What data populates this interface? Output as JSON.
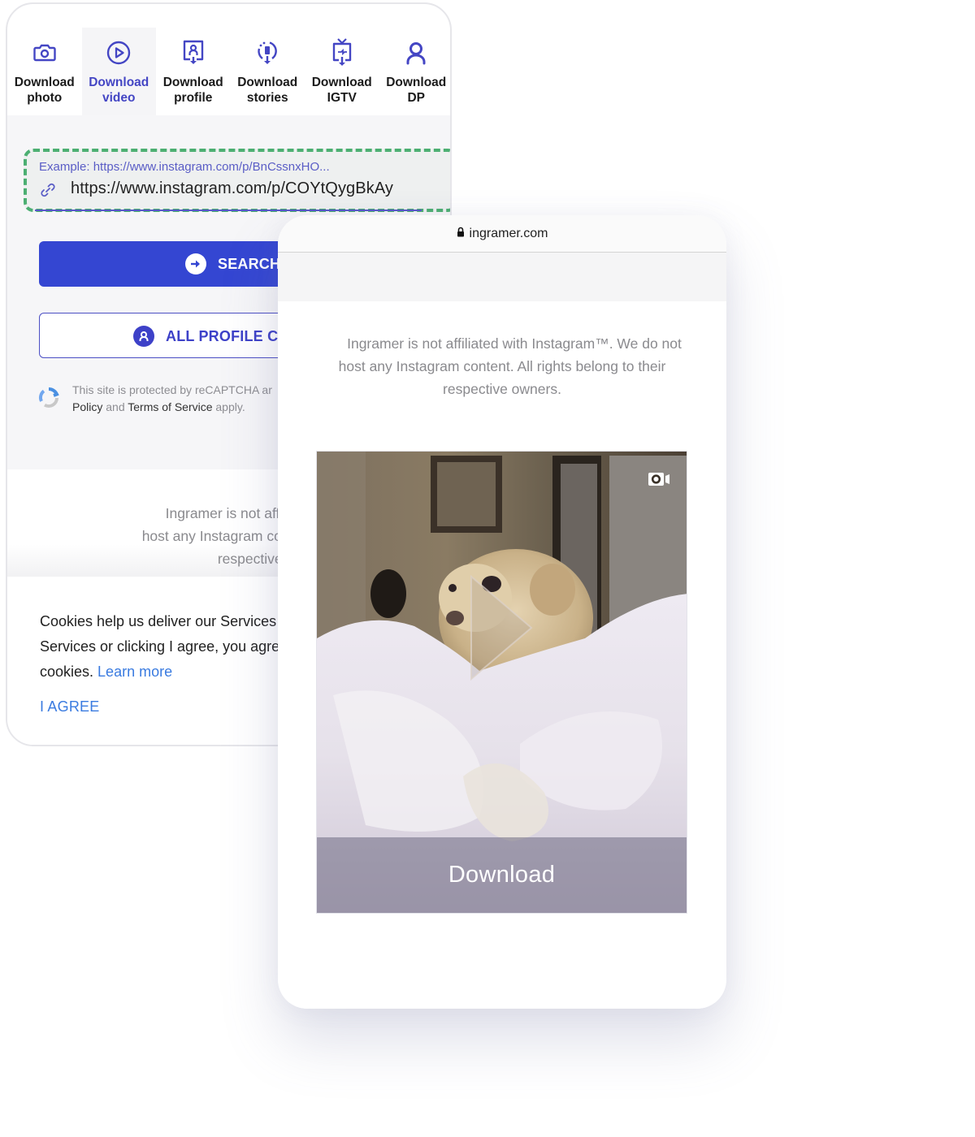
{
  "left_panel": {
    "tabs": [
      {
        "label_line1": "Download",
        "label_line2": "photo",
        "icon": "camera-icon",
        "active": false
      },
      {
        "label_line1": "Download",
        "label_line2": "video",
        "icon": "play-circle-icon",
        "active": true
      },
      {
        "label_line1": "Download",
        "label_line2": "profile",
        "icon": "profile-download-icon",
        "active": false
      },
      {
        "label_line1": "Download",
        "label_line2": "stories",
        "icon": "stories-download-icon",
        "active": false
      },
      {
        "label_line1": "Download",
        "label_line2": "IGTV",
        "icon": "igtv-download-icon",
        "active": false
      },
      {
        "label_line1": "Download",
        "label_line2": "DP",
        "icon": "user-icon",
        "active": false
      }
    ],
    "url_input": {
      "placeholder": "Example: https://www.instagram.com/p/BnCssnxHO...",
      "value": "https://www.instagram.com/p/COYtQygBkAy"
    },
    "search_button": "SEARCH",
    "profile_button": "ALL PROFILE CO",
    "recaptcha": {
      "line1": "This site is protected by reCAPTCHA ar",
      "line2_a": "Policy",
      "line2_b": " and ",
      "line2_c": "Terms of Service",
      "line2_d": " apply."
    },
    "disclaimer": {
      "line1": "Ingramer is not affiliated with Ins",
      "line2": "host any Instagram content. All rig",
      "line3": "respective owner"
    },
    "cookie": {
      "line1": "Cookies help us deliver our Services",
      "line2": "Services or clicking I agree, you agre",
      "line3": "cookies. ",
      "learn_more": "Learn more",
      "agree": "I AGREE"
    }
  },
  "right_panel": {
    "address_bar": {
      "domain": "ingramer.com",
      "icon": "lock-icon"
    },
    "disclaimer": {
      "line1": "Ingramer is not affiliated with Instagram™. We do not",
      "line2": "host any Instagram content. All rights belong to their",
      "line3": "respective owners."
    },
    "video": {
      "type_icon": "video-camera-icon",
      "download_label": "Download"
    }
  },
  "colors": {
    "accent": "#3446d2",
    "tab_active": "#4446c4",
    "dashed_highlight": "#4caf72",
    "link": "#3a7be0"
  }
}
